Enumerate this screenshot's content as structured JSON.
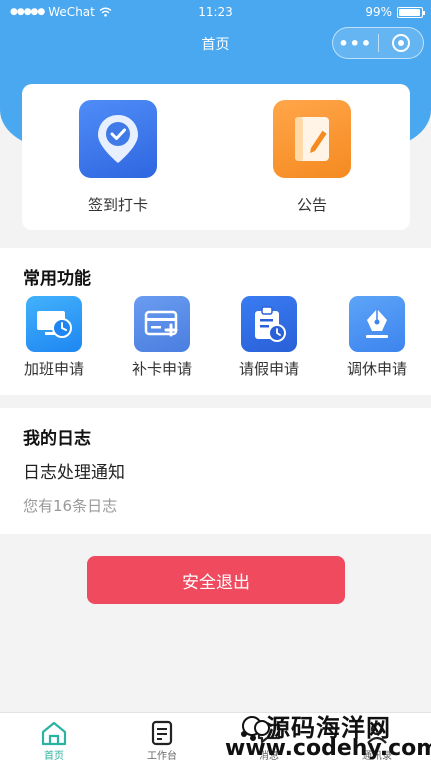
{
  "status_bar": {
    "signal": "●●●●●",
    "carrier": "WeChat",
    "time": "11:23",
    "battery": "99%"
  },
  "nav": {
    "title": "首页",
    "more_label": "•••"
  },
  "top_card": {
    "items": [
      {
        "label": "签到打卡",
        "icon": "location-check-icon"
      },
      {
        "label": "公告",
        "icon": "notebook-pen-icon"
      }
    ]
  },
  "functions": {
    "title": "常用功能",
    "items": [
      {
        "label": "加班申请",
        "icon": "monitor-clock-icon"
      },
      {
        "label": "补卡申请",
        "icon": "card-plus-icon"
      },
      {
        "label": "请假申请",
        "icon": "clipboard-clock-icon"
      },
      {
        "label": "调休申请",
        "icon": "pen-nib-icon"
      }
    ]
  },
  "diary": {
    "title": "我的日志",
    "heading": "日志处理通知",
    "subtitle": "您有16条日志"
  },
  "logout": {
    "label": "安全退出"
  },
  "tabbar": {
    "items": [
      {
        "label": "首页",
        "icon": "home-icon",
        "active": true
      },
      {
        "label": "工作台",
        "icon": "document-icon",
        "active": false
      },
      {
        "label": "消息",
        "icon": "message-icon",
        "active": false
      },
      {
        "label": "通讯录",
        "icon": "contacts-icon",
        "active": false
      }
    ]
  },
  "watermark": {
    "line1": "源码海洋网",
    "line2": "www.codehy.com"
  },
  "colors": {
    "header_blue": "#4aa8f0",
    "logout_red": "#ef4a5e",
    "tab_active": "#2bb3a0"
  }
}
